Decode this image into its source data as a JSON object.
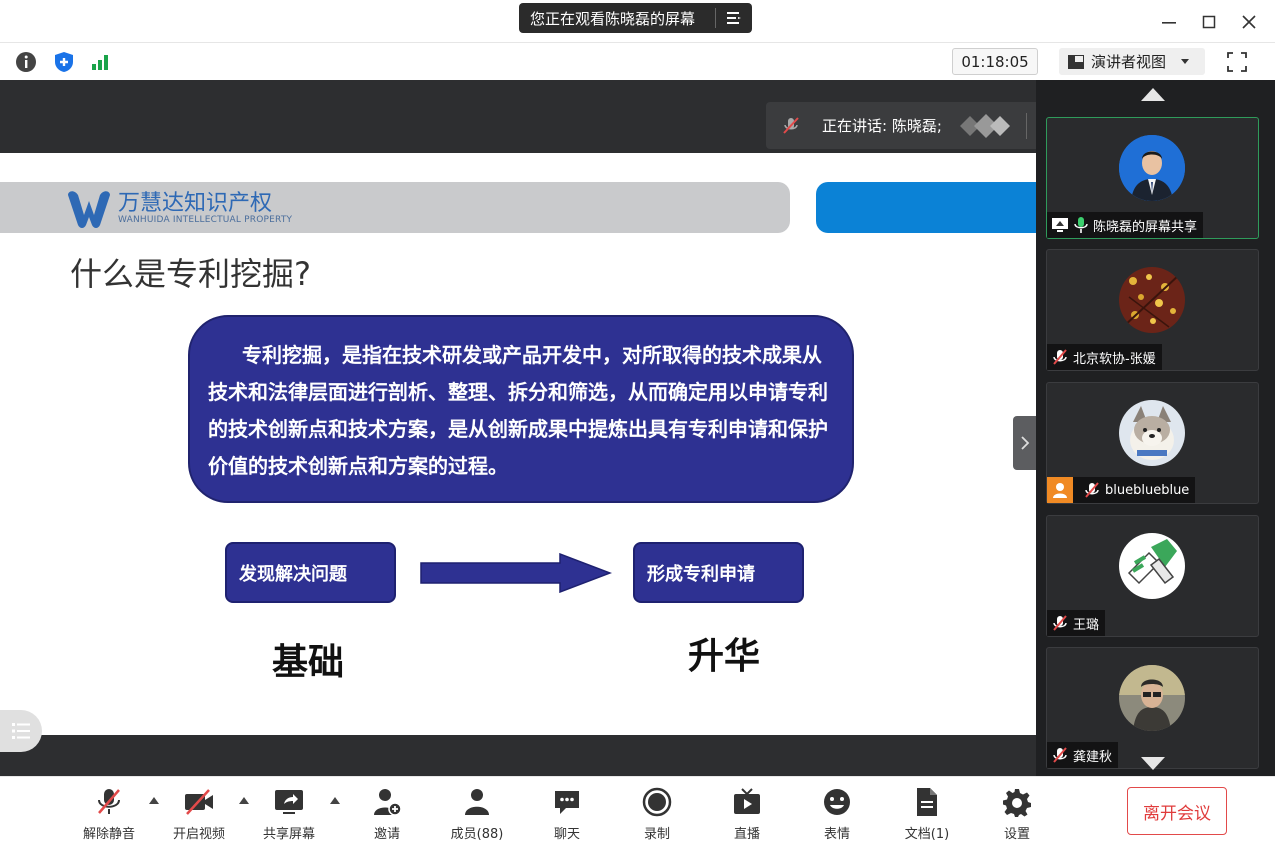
{
  "titlebar": {
    "share_notice": "您正在观看陈晓磊的屏幕",
    "minimize": "—",
    "maximize": "☐",
    "close": "✕"
  },
  "toolbar_top": {
    "timer": "01:18:05",
    "view_mode": "演讲者视图",
    "icons": [
      "info-icon",
      "shield-icon",
      "signal-icon"
    ]
  },
  "stage": {
    "speaking_label": "正在讲话: 陈晓磊;",
    "slide": {
      "logo_cn": "万慧达知识产权",
      "logo_en": "WANHUIDA INTELLECTUAL PROPERTY",
      "title": "什么是专利挖掘?",
      "definition": "专利挖掘，是指在技术研发或产品开发中，对所取得的技术成果从技术和法律层面进行剖析、整理、拆分和筛选，从而确定用以申请专利的技术创新点和技术方案，是从创新成果中提炼出具有专利申请和保护价值的技术创新点和方案的过程。",
      "step_left": "发现解决问题",
      "step_right": "形成专利申请",
      "label_left": "基础",
      "label_right": "升华"
    }
  },
  "participants": [
    {
      "name": "陈晓磊的屏幕共享",
      "mic": "on",
      "sharing": true,
      "active": true
    },
    {
      "name": "北京软协-张媛",
      "mic": "muted"
    },
    {
      "name": "blueblueblue",
      "mic": "muted",
      "badge": "user-icon"
    },
    {
      "name": "王璐",
      "mic": "muted"
    },
    {
      "name": "龚建秋",
      "mic": "muted"
    }
  ],
  "bottom_toolbar": {
    "unmute": "解除静音",
    "start_video": "开启视频",
    "share_screen": "共享屏幕",
    "invite": "邀请",
    "members": "成员(88)",
    "chat": "聊天",
    "record": "录制",
    "live": "直播",
    "reaction": "表情",
    "docs": "文档(1)",
    "settings": "设置",
    "leave": "离开会议"
  },
  "colors": {
    "slide_box": "#2e3192",
    "leave_red": "#e03c3c",
    "active_tile": "#2f9b5b",
    "logo_blue": "#0b82d6"
  }
}
